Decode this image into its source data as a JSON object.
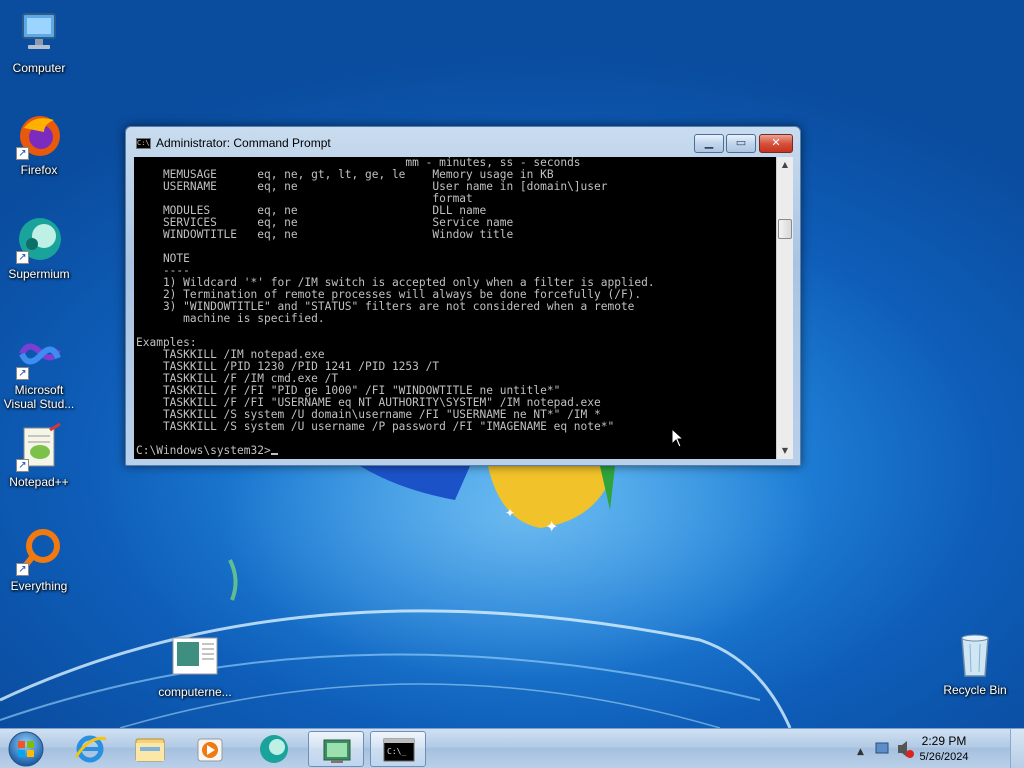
{
  "desktop": {
    "icons": [
      {
        "label": "Computer",
        "icon": "computer-icon"
      },
      {
        "label": "Firefox",
        "icon": "firefox-icon"
      },
      {
        "label": "Supermium",
        "icon": "supermium-icon"
      },
      {
        "label": "Microsoft Visual Stud...",
        "icon": "visual-studio-icon"
      },
      {
        "label": "Notepad++",
        "icon": "notepad-plus-plus-icon"
      },
      {
        "label": "Everything",
        "icon": "everything-search-icon"
      },
      {
        "label": "computerne...",
        "icon": "document-icon"
      },
      {
        "label": "Recycle Bin",
        "icon": "recycle-bin-icon"
      }
    ]
  },
  "window": {
    "title": "Administrator: Command Prompt",
    "minimize_label": "▁",
    "maximize_label": "▭",
    "close_label": "✕",
    "console_lines": [
      "                                        mm - minutes, ss - seconds",
      "    MEMUSAGE      eq, ne, gt, lt, ge, le    Memory usage in KB",
      "    USERNAME      eq, ne                    User name in [domain\\]user",
      "                                            format",
      "    MODULES       eq, ne                    DLL name",
      "    SERVICES      eq, ne                    Service name",
      "    WINDOWTITLE   eq, ne                    Window title",
      "",
      "    NOTE",
      "    ----",
      "    1) Wildcard '*' for /IM switch is accepted only when a filter is applied.",
      "    2) Termination of remote processes will always be done forcefully (/F).",
      "    3) \"WINDOWTITLE\" and \"STATUS\" filters are not considered when a remote",
      "       machine is specified.",
      "",
      "Examples:",
      "    TASKKILL /IM notepad.exe",
      "    TASKKILL /PID 1230 /PID 1241 /PID 1253 /T",
      "    TASKKILL /F /IM cmd.exe /T",
      "    TASKKILL /F /FI \"PID ge 1000\" /FI \"WINDOWTITLE ne untitle*\"",
      "    TASKKILL /F /FI \"USERNAME eq NT AUTHORITY\\SYSTEM\" /IM notepad.exe",
      "    TASKKILL /S system /U domain\\username /FI \"USERNAME ne NT*\" /IM *",
      "    TASKKILL /S system /U username /P password /FI \"IMAGENAME eq note*\"",
      ""
    ],
    "prompt": "C:\\Windows\\system32>"
  },
  "taskbar": {
    "items": [
      {
        "icon": "internet-explorer-icon"
      },
      {
        "icon": "file-explorer-icon"
      },
      {
        "icon": "media-player-icon"
      },
      {
        "icon": "supermium-icon"
      },
      {
        "icon": "network-monitor-icon"
      },
      {
        "icon": "command-prompt-icon"
      }
    ],
    "clock_time": "2:29 PM",
    "clock_date": "5/26/2024"
  },
  "colors": {
    "console_bg": "#000000",
    "console_fg": "#c0c0c0",
    "wallpaper": "#1a6fcc"
  }
}
